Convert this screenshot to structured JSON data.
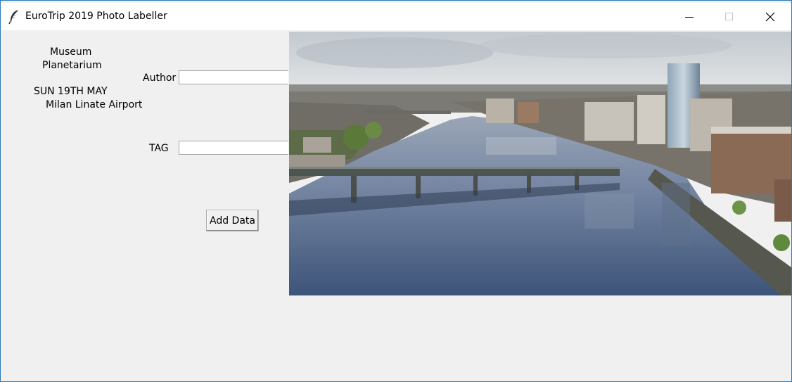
{
  "window": {
    "title": "EuroTrip 2019 Photo Labeller",
    "icon": "feather-icon",
    "controls": [
      "minimize-icon",
      "maximize-icon",
      "close-icon"
    ]
  },
  "info": {
    "line1": "Museum",
    "line2": "Planetarium",
    "date": "SUN 19TH MAY",
    "location": "Milan Linate Airport"
  },
  "form": {
    "author_label": "Author",
    "author_value": "",
    "tag_label": "TAG",
    "tag_value": "",
    "add_button_label": "Add Data"
  },
  "colors": {
    "window_bg": "#f0f0f0",
    "titlebar_bg": "#ffffff",
    "window_border": "#2a7ab8"
  }
}
